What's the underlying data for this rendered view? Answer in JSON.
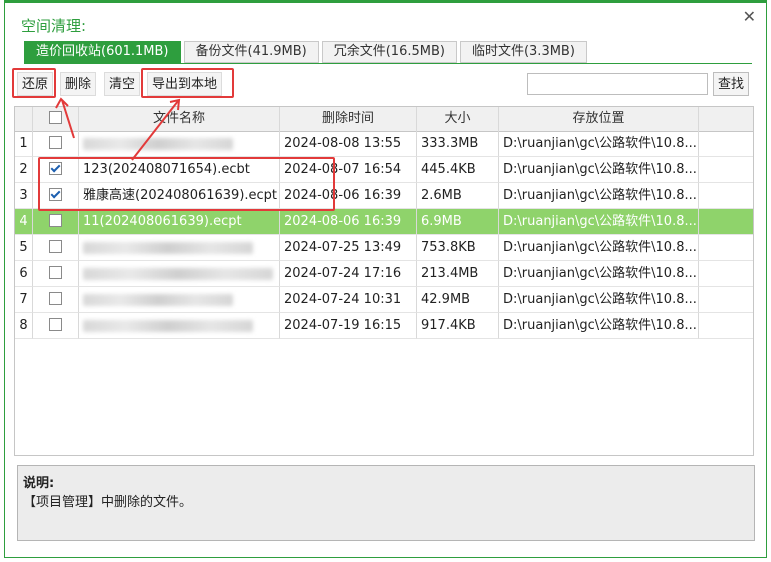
{
  "window": {
    "title": "空间清理:",
    "close_glyph": "✕"
  },
  "tabs": [
    {
      "label": "造价回收站(601.1MB)",
      "active": true
    },
    {
      "label": "备份文件(41.9MB)",
      "active": false
    },
    {
      "label": "冗余文件(16.5MB)",
      "active": false
    },
    {
      "label": "临时文件(3.3MB)",
      "active": false
    }
  ],
  "toolbar": {
    "restore_label": "还原",
    "delete_label": "删除",
    "clear_label": "清空",
    "export_label": "导出到本地",
    "search_placeholder": "",
    "search_label": "查找"
  },
  "table": {
    "headers": {
      "name": "文件名称",
      "time": "删除时间",
      "size": "大小",
      "location": "存放位置"
    },
    "rows": [
      {
        "idx": "1",
        "checked": false,
        "name": "",
        "blurred": true,
        "time": "2024-08-08 13:55",
        "size": "333.3MB",
        "location": "D:\\ruanjian\\gc\\公路软件\\10.8...",
        "selected": false
      },
      {
        "idx": "2",
        "checked": true,
        "name": "123(202408071654).ecbt",
        "blurred": false,
        "time": "2024-08-07 16:54",
        "size": "445.4KB",
        "location": "D:\\ruanjian\\gc\\公路软件\\10.8...",
        "selected": false
      },
      {
        "idx": "3",
        "checked": true,
        "name": "雅康高速(202408061639).ecpt",
        "blurred": false,
        "time": "2024-08-06 16:39",
        "size": "2.6MB",
        "location": "D:\\ruanjian\\gc\\公路软件\\10.8...",
        "selected": false
      },
      {
        "idx": "4",
        "checked": false,
        "name": "11(202408061639).ecpt",
        "blurred": false,
        "time": "2024-08-06 16:39",
        "size": "6.9MB",
        "location": "D:\\ruanjian\\gc\\公路软件\\10.8...",
        "selected": true
      },
      {
        "idx": "5",
        "checked": false,
        "name": "",
        "blurred": true,
        "time": "2024-07-25 13:49",
        "size": "753.8KB",
        "location": "D:\\ruanjian\\gc\\公路软件\\10.8...",
        "selected": false
      },
      {
        "idx": "6",
        "checked": false,
        "name": "",
        "blurred": true,
        "time": "2024-07-24 17:16",
        "size": "213.4MB",
        "location": "D:\\ruanjian\\gc\\公路软件\\10.8...",
        "selected": false
      },
      {
        "idx": "7",
        "checked": false,
        "name": "",
        "blurred": true,
        "time": "2024-07-24 10:31",
        "size": "42.9MB",
        "location": "D:\\ruanjian\\gc\\公路软件\\10.8...",
        "selected": false
      },
      {
        "idx": "8",
        "checked": false,
        "name": "",
        "blurred": true,
        "time": "2024-07-19 16:15",
        "size": "917.4KB",
        "location": "D:\\ruanjian\\gc\\公路软件\\10.8...",
        "selected": false
      }
    ]
  },
  "description": {
    "label": "说明:",
    "text": "【项目管理】中删除的文件。"
  },
  "colors": {
    "accent": "#2e9e3e",
    "selected_row": "#8fd36b",
    "annotation": "#e23a3a"
  }
}
